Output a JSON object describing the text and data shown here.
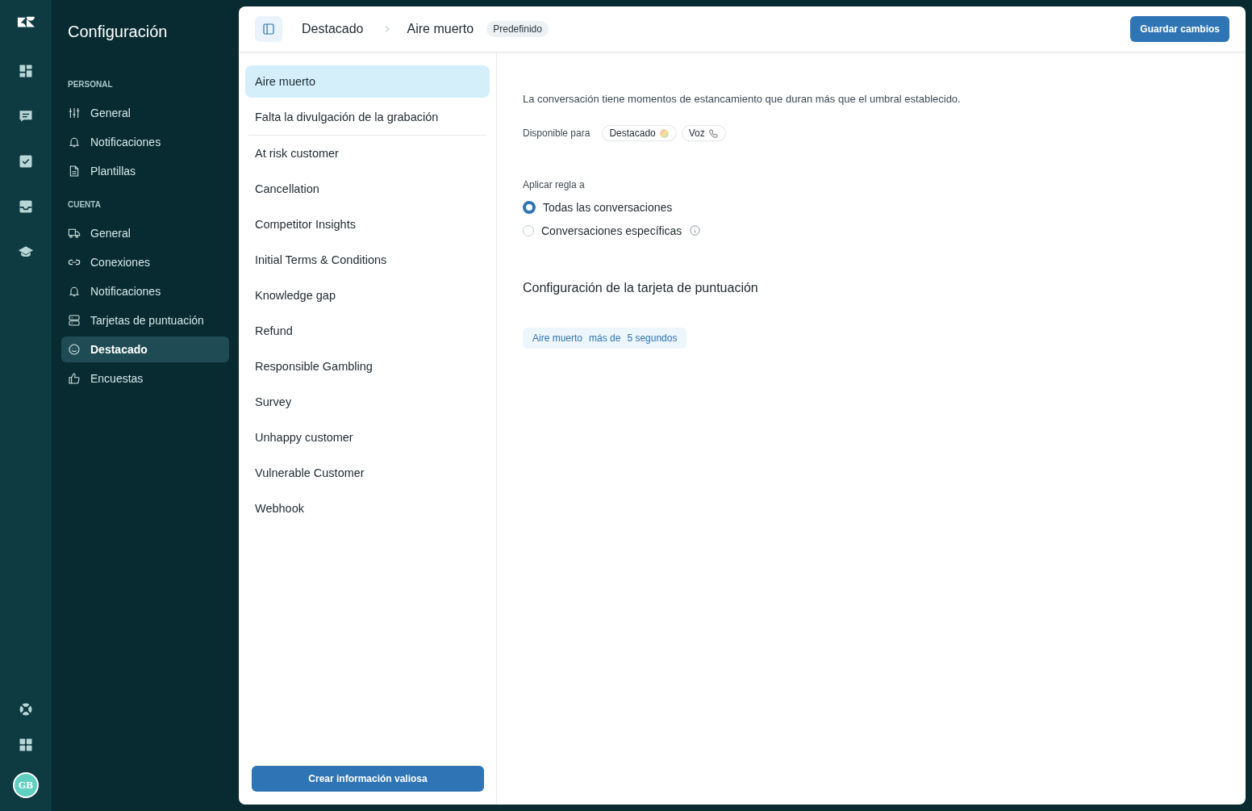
{
  "rail": {
    "top": [
      {
        "kind": "dashboard",
        "selected": false
      },
      {
        "kind": "chat",
        "selected": false
      },
      {
        "kind": "check",
        "selected": false
      },
      {
        "kind": "inbox",
        "selected": false
      },
      {
        "kind": "cap",
        "selected": false
      }
    ],
    "bottom": [
      {
        "kind": "help"
      },
      {
        "kind": "apps"
      }
    ],
    "avatar": "GB"
  },
  "sidebar": {
    "title": "Configuración",
    "sections": [
      {
        "heading": "PERSONAL",
        "items": [
          {
            "label": "General",
            "kind": "sliders",
            "selected": false
          },
          {
            "label": "Notificaciones",
            "kind": "bell",
            "selected": false
          },
          {
            "label": "Plantillas",
            "kind": "doc",
            "selected": false
          }
        ]
      },
      {
        "heading": "CUENTA",
        "items": [
          {
            "label": "General",
            "kind": "truck",
            "selected": false
          },
          {
            "label": "Conexiones",
            "kind": "link",
            "selected": false
          },
          {
            "label": "Notificaciones",
            "kind": "bell",
            "selected": false
          },
          {
            "label": "Tarjetas de puntuación",
            "kind": "cards",
            "selected": false
          },
          {
            "label": "Destacado",
            "kind": "smile",
            "selected": true
          },
          {
            "label": "Encuestas",
            "kind": "thumb",
            "selected": false
          }
        ]
      }
    ]
  },
  "header": {
    "breadcrumb": [
      "Destacado",
      "Aire muerto"
    ],
    "badge": "Predefinido",
    "save_button": "Guardar cambios"
  },
  "rules": {
    "items": [
      {
        "label": "Aire muerto",
        "selected": true
      },
      {
        "label": "Falta la divulgación de la grabación",
        "selected": false
      },
      {
        "label": "At risk customer",
        "selected": false
      },
      {
        "label": "Cancellation",
        "selected": false
      },
      {
        "label": "Competitor Insights",
        "selected": false
      },
      {
        "label": "Initial Terms & Conditions",
        "selected": false
      },
      {
        "label": "Knowledge gap",
        "selected": false
      },
      {
        "label": "Refund",
        "selected": false
      },
      {
        "label": "Responsible Gambling",
        "selected": false
      },
      {
        "label": "Survey",
        "selected": false
      },
      {
        "label": "Unhappy customer",
        "selected": false
      },
      {
        "label": "Vulnerable Customer",
        "selected": false
      },
      {
        "label": "Webhook",
        "selected": false
      }
    ],
    "create_button": "Crear información valiosa"
  },
  "detail": {
    "description": "La conversación tiene momentos de estancamiento que duran más que el umbral establecido.",
    "available_label": "Disponible para",
    "channels": [
      {
        "label": "Destacado",
        "kind": "orb"
      },
      {
        "label": "Voz",
        "kind": "phone"
      }
    ],
    "apply_label": "Aplicar regla a",
    "options": [
      {
        "label": "Todas las conversaciones",
        "selected": true,
        "info": false
      },
      {
        "label": "Conversaciones específicas",
        "selected": false,
        "info": true
      }
    ],
    "scorecard_title": "Configuración de la tarjeta de puntuación",
    "condition": [
      "Aire muerto",
      "más de",
      "5 segundos"
    ]
  }
}
